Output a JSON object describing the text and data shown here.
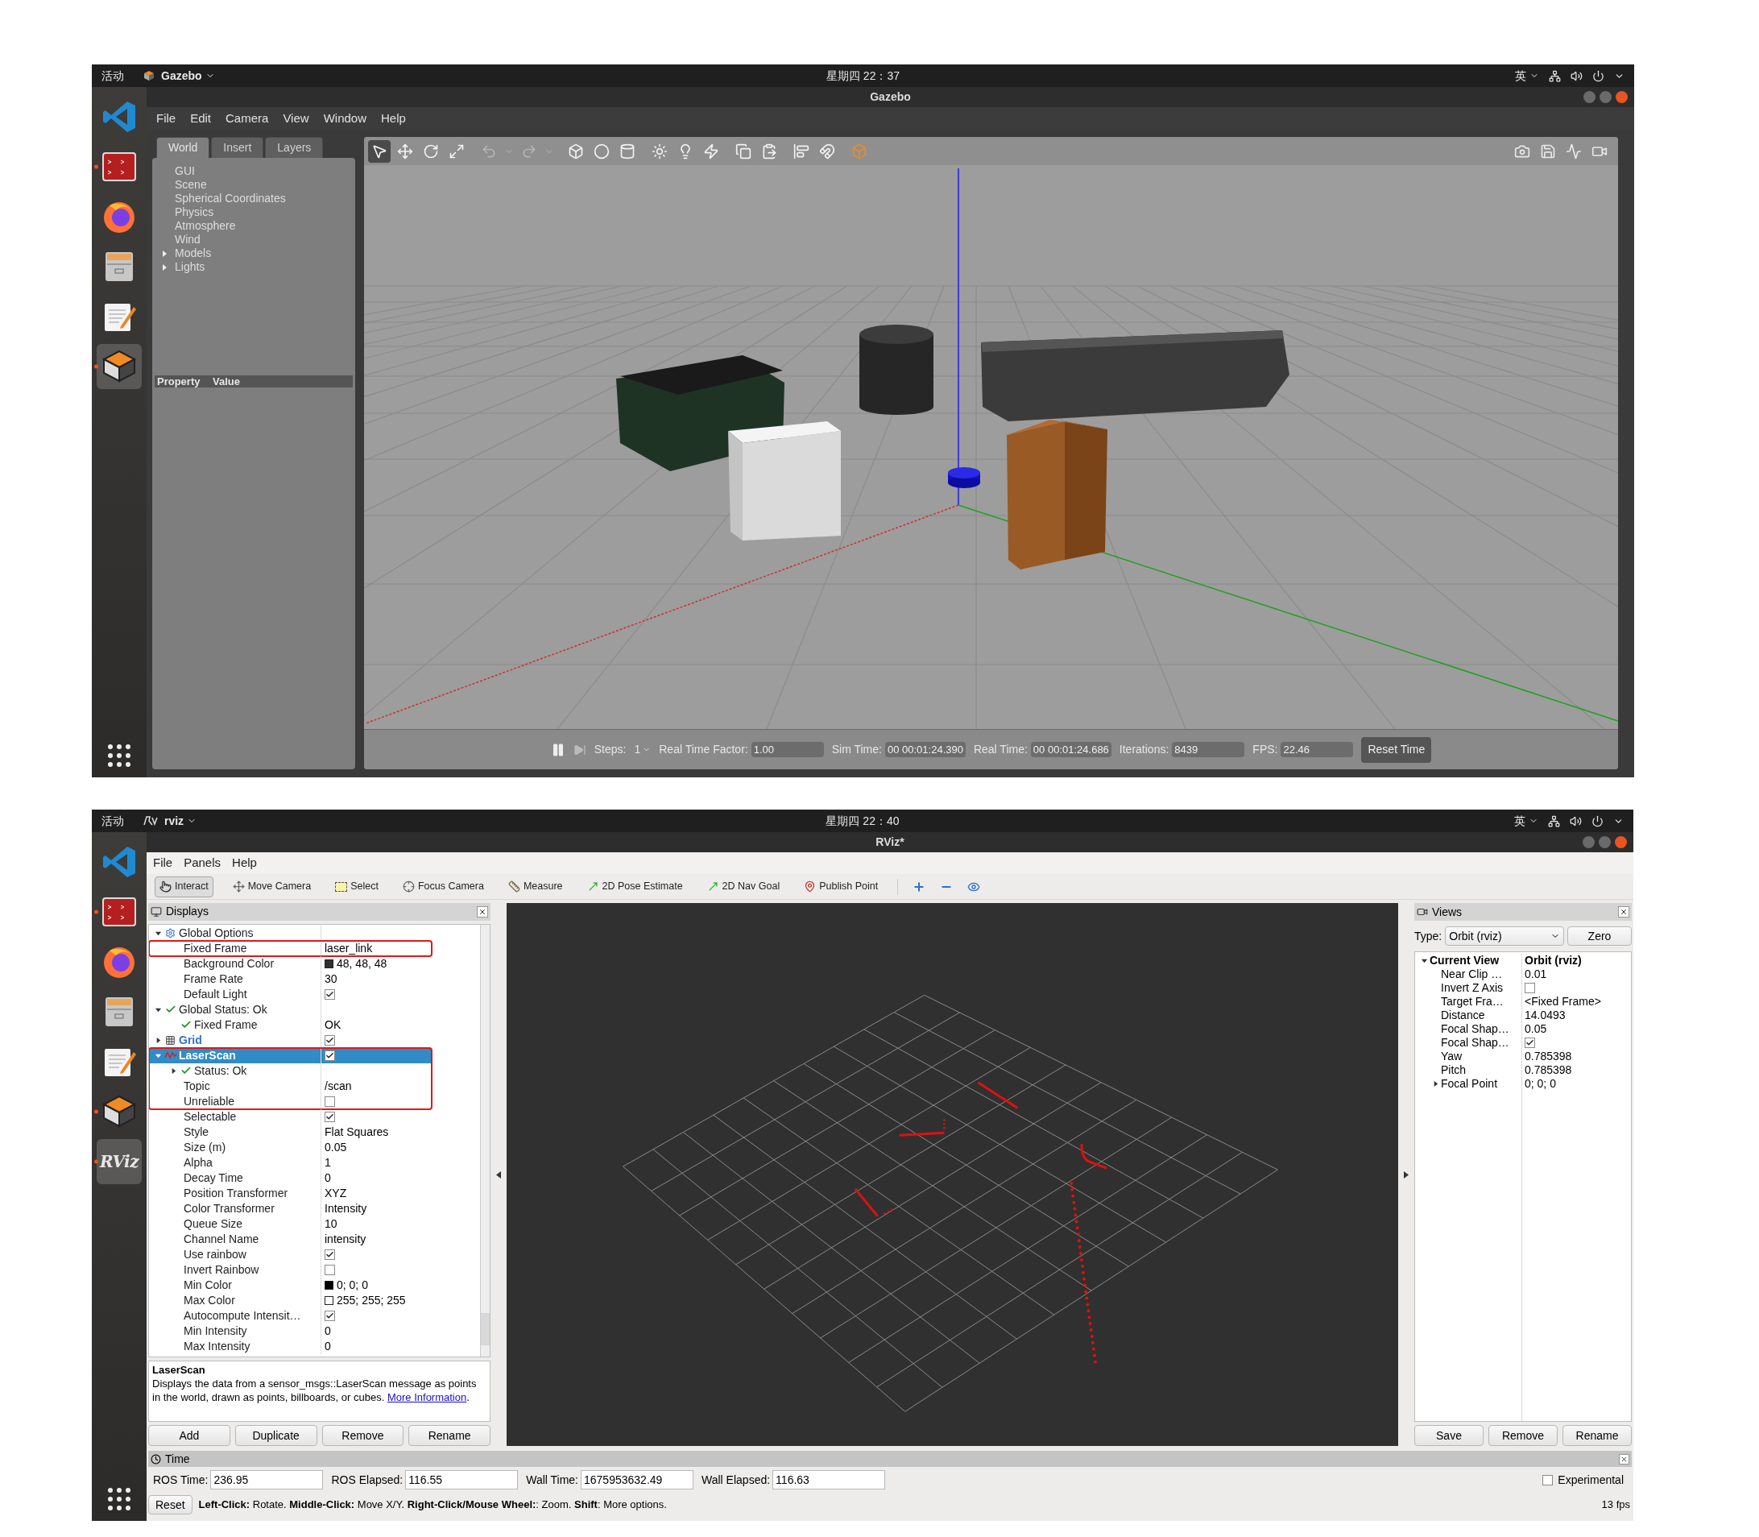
{
  "gazebo": {
    "top_bar": {
      "activities": "活动",
      "app": "Gazebo",
      "clock": "星期四 22：37",
      "input_method": "英"
    },
    "dock": [
      {
        "kind": "code",
        "running": false,
        "active": false
      },
      {
        "kind": "terminal",
        "running": true,
        "active": false
      },
      {
        "kind": "browser",
        "running": false,
        "active": false
      },
      {
        "kind": "files",
        "running": false,
        "active": false
      },
      {
        "kind": "editor",
        "running": false,
        "active": false
      },
      {
        "kind": "gazebo",
        "running": true,
        "active": true
      }
    ],
    "window_title": "Gazebo",
    "menu": [
      "File",
      "Edit",
      "Camera",
      "View",
      "Window",
      "Help"
    ],
    "tabs": [
      {
        "label": "World",
        "selected": true
      },
      {
        "label": "Insert",
        "selected": false
      },
      {
        "label": "Layers",
        "selected": false
      }
    ],
    "world_tree": [
      {
        "label": "GUI"
      },
      {
        "label": "Scene"
      },
      {
        "label": "Spherical Coordinates"
      },
      {
        "label": "Physics"
      },
      {
        "label": "Atmosphere"
      },
      {
        "label": "Wind"
      },
      {
        "label": "Models",
        "expanded": false
      },
      {
        "label": "Lights",
        "expanded": false
      }
    ],
    "property_header": {
      "property": "Property",
      "value": "Value"
    },
    "toolbar": [
      {
        "selected": true
      },
      {
        "selected": false
      },
      {
        "selected": false
      },
      {
        "selected": false
      },
      {
        "selected": false
      },
      {
        "selected": false
      },
      {
        "selected": false
      },
      {
        "selected": false
      },
      {
        "selected": false
      },
      {
        "selected": false
      },
      {
        "selected": false
      },
      {
        "selected": false
      },
      {
        "selected": false
      },
      {
        "selected": false
      },
      {
        "selected": false
      },
      {
        "selected": false
      },
      {
        "selected": false
      },
      {
        "selected": false
      },
      {
        "selected": false
      }
    ],
    "status_bar": {
      "steps_label": "Steps:",
      "steps": "1",
      "fields": [
        {
          "label": "Real Time Factor:",
          "value": "1.00"
        },
        {
          "label": "Sim Time:",
          "value": "00 00:01:24.390"
        },
        {
          "label": "Real Time:",
          "value": "00 00:01:24.686"
        },
        {
          "label": "Iterations:",
          "value": "8439"
        },
        {
          "label": "FPS:",
          "value": "22.46"
        }
      ],
      "reset": "Reset Time"
    }
  },
  "rviz": {
    "top_bar": {
      "activities": "活动",
      "app": "rviz",
      "clock": "星期四 22：40",
      "input_method": "英"
    },
    "dock": [
      {
        "kind": "code",
        "running": false,
        "active": false
      },
      {
        "kind": "terminal",
        "running": true,
        "active": false
      },
      {
        "kind": "browser",
        "running": false,
        "active": false
      },
      {
        "kind": "files",
        "running": false,
        "active": false
      },
      {
        "kind": "editor",
        "running": false,
        "active": false
      },
      {
        "kind": "gazebo",
        "running": true,
        "active": false
      },
      {
        "kind": "rviz",
        "label": "RViz",
        "running": true,
        "active": true
      }
    ],
    "window_title": "RViz*",
    "menu": [
      "File",
      "Panels",
      "Help"
    ],
    "tools": [
      {
        "label": "Interact",
        "selected": true
      },
      {
        "label": "Move Camera",
        "selected": false
      },
      {
        "label": "Select",
        "selected": false
      },
      {
        "label": "Focus Camera",
        "selected": false
      },
      {
        "label": "Measure",
        "selected": false
      },
      {
        "label": "2D Pose Estimate",
        "selected": false
      },
      {
        "label": "2D Nav Goal",
        "selected": false
      },
      {
        "label": "Publish Point",
        "selected": false
      }
    ],
    "displays": {
      "title": "Displays",
      "tree": [
        {
          "label": "Global Options",
          "kind": "options",
          "expanded": true,
          "selected": false,
          "marked": false,
          "children": [
            {
              "label": "Fixed Frame",
              "kind": "property",
              "value": "laser_link",
              "selected": false,
              "marked": true
            },
            {
              "label": "Background Color",
              "kind": "property",
              "color": "#303030",
              "value": "48, 48, 48",
              "selected": false,
              "marked": false
            },
            {
              "label": "Frame Rate",
              "kind": "property",
              "value": "30",
              "selected": false,
              "marked": false
            },
            {
              "label": "Default Light",
              "kind": "property",
              "checked": true,
              "selected": false,
              "marked": false
            }
          ]
        },
        {
          "label": "Global Status: Ok",
          "kind": "status",
          "expanded": true,
          "selected": false,
          "marked": false,
          "children": [
            {
              "label": "Fixed Frame",
              "kind": "status",
              "value": "OK",
              "selected": false,
              "marked": false
            }
          ]
        },
        {
          "label": "Grid",
          "kind": "grid",
          "checked": true,
          "expanded": false,
          "selected": false,
          "marked": false
        },
        {
          "label": "LaserScan",
          "kind": "scan",
          "checked": true,
          "expanded": true,
          "selected": true,
          "marked": true,
          "children": [
            {
              "label": "Status: Ok",
              "kind": "status",
              "expanded": false,
              "selected": false,
              "marked": true
            },
            {
              "label": "Topic",
              "kind": "property",
              "value": "/scan",
              "selected": false,
              "marked": true
            },
            {
              "label": "Unreliable",
              "kind": "property",
              "checked": false,
              "selected": false,
              "marked": true
            },
            {
              "label": "Selectable",
              "kind": "property",
              "checked": true,
              "selected": false,
              "marked": false
            },
            {
              "label": "Style",
              "kind": "property",
              "value": "Flat Squares",
              "selected": false,
              "marked": false
            },
            {
              "label": "Size (m)",
              "kind": "property",
              "value": "0.05",
              "selected": false,
              "marked": false
            },
            {
              "label": "Alpha",
              "kind": "property",
              "value": "1",
              "selected": false,
              "marked": false
            },
            {
              "label": "Decay Time",
              "kind": "property",
              "value": "0",
              "selected": false,
              "marked": false
            },
            {
              "label": "Position Transformer",
              "kind": "property",
              "value": "XYZ",
              "selected": false,
              "marked": false
            },
            {
              "label": "Color Transformer",
              "kind": "property",
              "value": "Intensity",
              "selected": false,
              "marked": false
            },
            {
              "label": "Queue Size",
              "kind": "property",
              "value": "10",
              "selected": false,
              "marked": false
            },
            {
              "label": "Channel Name",
              "kind": "property",
              "value": "intensity",
              "selected": false,
              "marked": false
            },
            {
              "label": "Use rainbow",
              "kind": "property",
              "checked": true,
              "selected": false,
              "marked": false
            },
            {
              "label": "Invert Rainbow",
              "kind": "property",
              "checked": false,
              "selected": false,
              "marked": false
            },
            {
              "label": "Min Color",
              "kind": "property",
              "color": "#000000",
              "value": "0; 0; 0",
              "selected": false,
              "marked": false
            },
            {
              "label": "Max Color",
              "kind": "property",
              "color": "#ffffff",
              "value": "255; 255; 255",
              "selected": false,
              "marked": false
            },
            {
              "label": "Autocompute Intensit…",
              "kind": "property",
              "checked": true,
              "selected": false,
              "marked": false
            },
            {
              "label": "Min Intensity",
              "kind": "property",
              "value": "0",
              "selected": false,
              "marked": false
            },
            {
              "label": "Max Intensity",
              "kind": "property",
              "value": "0",
              "selected": false,
              "marked": false
            }
          ]
        }
      ],
      "description": {
        "title": "LaserScan",
        "text": "Displays the data from a sensor_msgs::LaserScan message as points in the world, drawn as points, billboards, or cubes.",
        "link": "More Information",
        "after_link": "."
      },
      "buttons": [
        "Add",
        "Duplicate",
        "Remove",
        "Rename"
      ]
    },
    "views": {
      "title": "Views",
      "type_label": "Type:",
      "type_value": "Orbit (rviz)",
      "zero": "Zero",
      "tree": [
        {
          "label": "Current View",
          "value": "Orbit (rviz)",
          "expanded": true,
          "children": [
            {
              "label": "Near Clip …",
              "value": "0.01"
            },
            {
              "label": "Invert Z Axis",
              "checked": false
            },
            {
              "label": "Target Fra…",
              "value": "<Fixed Frame>"
            },
            {
              "label": "Distance",
              "value": "14.0493"
            },
            {
              "label": "Focal Shap…",
              "value": "0.05"
            },
            {
              "label": "Focal Shap…",
              "checked": true
            },
            {
              "label": "Yaw",
              "value": "0.785398"
            },
            {
              "label": "Pitch",
              "value": "0.785398"
            },
            {
              "label": "Focal Point",
              "value": "0; 0; 0",
              "expanded": false
            }
          ]
        }
      ],
      "buttons": [
        "Save",
        "Remove",
        "Rename"
      ]
    },
    "time": {
      "title": "Time",
      "fields": [
        {
          "label": "ROS Time:",
          "value": "236.95"
        },
        {
          "label": "ROS Elapsed:",
          "value": "116.55"
        },
        {
          "label": "Wall Time:",
          "value": "1675953632.49"
        },
        {
          "label": "Wall Elapsed:",
          "value": "116.63"
        }
      ],
      "experimental": {
        "label": "Experimental",
        "checked": false
      },
      "reset": "Reset",
      "hint": "**Left-Click:** Rotate. **Middle-Click:** Move X/Y. **Right-Click/Mouse Wheel:**: Zoom. **Shift**: More options.",
      "fps": "13 fps"
    }
  }
}
